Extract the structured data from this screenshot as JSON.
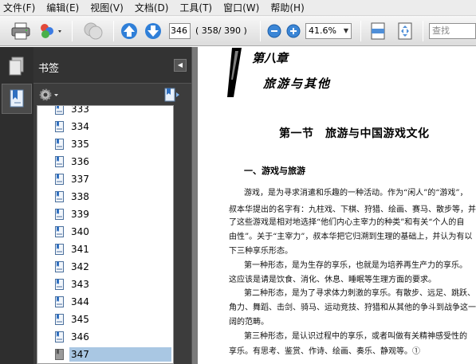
{
  "menubar": {
    "items": [
      "文件(F)",
      "编辑(E)",
      "视图(V)",
      "文档(D)",
      "工具(T)",
      "窗口(W)",
      "帮助(H)"
    ]
  },
  "toolbar": {
    "page_number": "346",
    "page_count": "( 358/ 390 )",
    "zoom": "41.6%",
    "search_placeholder": "查找",
    "icons": [
      "printer-icon",
      "collaborate-icon",
      "comment-icon",
      "previous-page-icon",
      "next-page-icon",
      "zoom-out-icon",
      "zoom-in-icon",
      "fit-width-icon",
      "fit-page-icon"
    ]
  },
  "strip": {
    "icons": [
      "pages-icon",
      "bookmarks-icon"
    ]
  },
  "panel": {
    "title": "书签",
    "items": [
      {
        "label": "333"
      },
      {
        "label": "334"
      },
      {
        "label": "335"
      },
      {
        "label": "336"
      },
      {
        "label": "337"
      },
      {
        "label": "338"
      },
      {
        "label": "339"
      },
      {
        "label": "340"
      },
      {
        "label": "341"
      },
      {
        "label": "342"
      },
      {
        "label": "343"
      },
      {
        "label": "344"
      },
      {
        "label": "345"
      },
      {
        "label": "346"
      },
      {
        "label": "347"
      }
    ],
    "selected_index": 14
  },
  "document": {
    "chapter_number": "第八章",
    "chapter_title": "旅游与其他",
    "section_title": "第一节　旅游与中国游戏文化",
    "subheading": "一、游戏与旅游",
    "lines": [
      "游戏，是为寻求消遣和乐趣的一种活动。作为“闲人”的“游戏”，",
      "叔本华提出的名字有：九柱戏、下棋、狩猎、绘画、赛马、散步等，并讲述",
      "了这些游戏是相对地选择“他们内心主宰力的种类”和有关“个人的自",
      "由性”。关于“主宰力”，叔本华把它归溯到生理的基础上，并认为有以",
      "下三种享乐形态。",
      "第一种形态，是为生存的享乐，也就是为培养再生产力的享乐。",
      "这应该是请是饮食、消化、休息、睡眠等生理方面的要求。",
      "第二种形态，是为了寻求体力刺激的享乐。有散步、远足、跳跃、",
      "角力、舞蹈、击剑、骑马、运动竞技、狩猎和从其他的争斗到战争这一广",
      "阔的范畴。",
      "第三种形态，是认识过程中的享乐，或者叫做有关精神感受性的",
      "享乐。有思考、鉴赏、作诗、绘画、奏乐、静观等。①"
    ]
  }
}
